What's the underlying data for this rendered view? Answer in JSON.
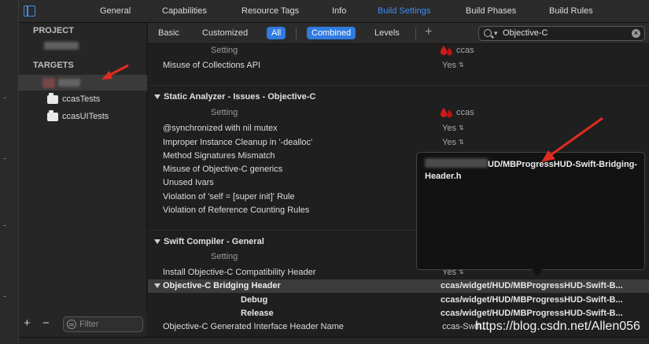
{
  "top_tabs": [
    "General",
    "Capabilities",
    "Resource Tags",
    "Info",
    "Build Settings",
    "Build Phases",
    "Build Rules"
  ],
  "active_top_tab": "Build Settings",
  "sidebar": {
    "project_header": "PROJECT",
    "targets_header": "TARGETS",
    "targets": [
      "ccasTests",
      "ccasUITests"
    ],
    "filter_placeholder": "Filter",
    "add_label": "+",
    "remove_label": "−"
  },
  "toolbar": {
    "basic": "Basic",
    "customized": "Customized",
    "all": "All",
    "combined": "Combined",
    "levels": "Levels",
    "add": "+",
    "search_value": "Objective-C"
  },
  "settings": {
    "setting_label": "Setting",
    "target_label": "ccas",
    "rows_top": [
      {
        "name": "Misuse of Collections API",
        "value": "Yes"
      }
    ],
    "static_analyzer": {
      "title": "Static Analyzer - Issues - Objective-C",
      "rows": [
        {
          "name": "@synchronized with nil mutex",
          "value": "Yes"
        },
        {
          "name": "Improper Instance Cleanup in '-dealloc'",
          "value": "Yes"
        },
        {
          "name": "Method Signatures Mismatch",
          "value": ""
        },
        {
          "name": "Misuse of Objective-C generics",
          "value": ""
        },
        {
          "name": "Unused Ivars",
          "value": ""
        },
        {
          "name": "Violation of 'self = [super init]' Rule",
          "value": ""
        },
        {
          "name": "Violation of Reference Counting Rules",
          "value": ""
        }
      ]
    },
    "swift_compiler": {
      "title": "Swift Compiler - General",
      "rows": [
        {
          "name": "Install Objective-C Compatibility Header",
          "value": "Yes"
        },
        {
          "name": "Objective-C Bridging Header",
          "value": "ccas/widget/HUD/MBProgressHUD-Swift-B..."
        },
        {
          "name": "Debug",
          "value": "ccas/widget/HUD/MBProgressHUD-Swift-B..."
        },
        {
          "name": "Release",
          "value": "ccas/widget/HUD/MBProgressHUD-Swift-B..."
        },
        {
          "name": "Objective-C Generated Interface Header Name",
          "value": "ccas-Swift..."
        }
      ]
    }
  },
  "popover_text": "UD/MBProgressHUD-Swift-Bridging-Header.h",
  "watermark": "https://blog.csdn.net/Allen056",
  "colors": {
    "accent": "#2f7be0",
    "arrow": "#e02b20"
  }
}
